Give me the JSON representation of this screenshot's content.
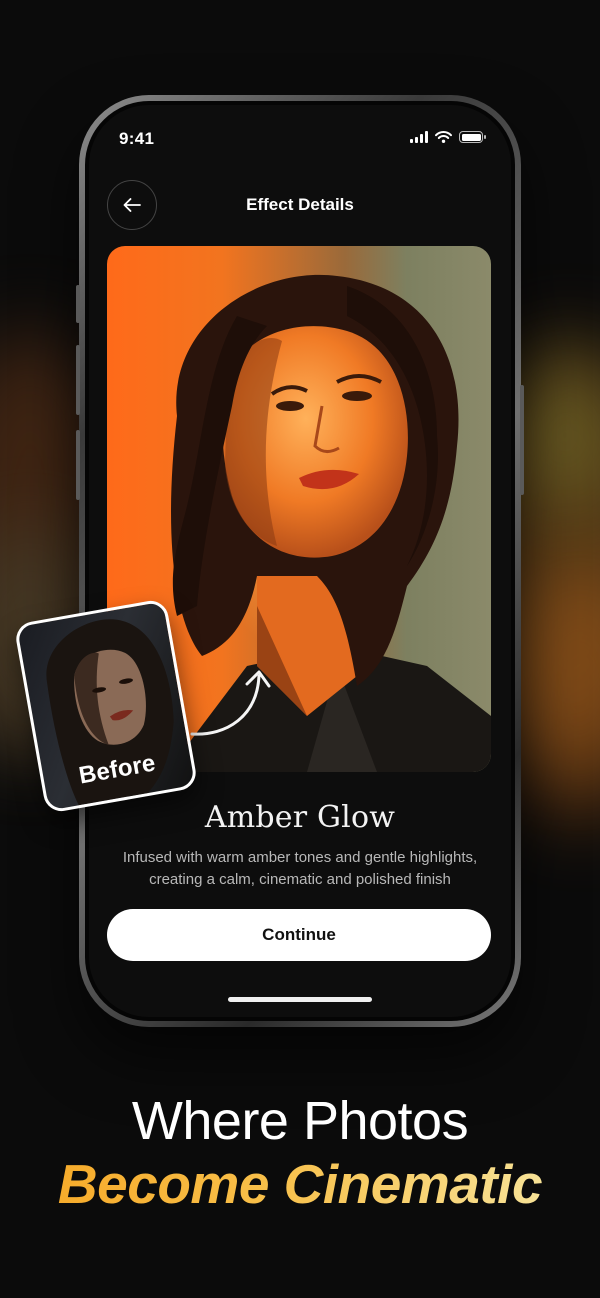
{
  "status_bar": {
    "time": "9:41"
  },
  "nav": {
    "title": "Effect Details"
  },
  "effect": {
    "name": "Amber Glow",
    "description": "Infused with warm amber tones and gentle highlights, creating a calm, cinematic and polished finish"
  },
  "cta": {
    "label": "Continue"
  },
  "comparison": {
    "before_label": "Before"
  },
  "headline": {
    "line1": "Where Photos",
    "line2": "Become Cinematic"
  },
  "colors": {
    "accent_gold": "#f6a623",
    "amber": "#ff7a1f",
    "background": "#0b0b0b"
  },
  "icons": [
    "back-arrow-icon",
    "signal-icon",
    "wifi-icon",
    "battery-icon",
    "curved-arrow-icon"
  ]
}
